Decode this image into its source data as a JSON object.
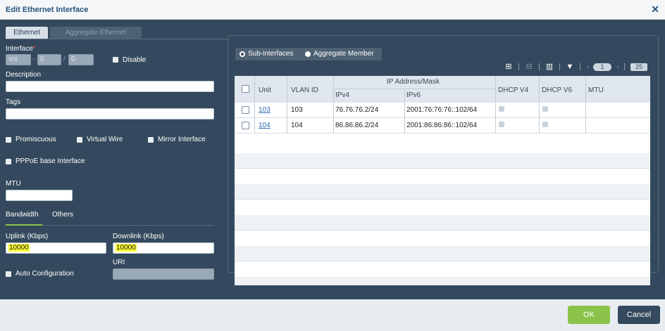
{
  "dialog": {
    "title": "Edit Ethernet Interface"
  },
  "tabs": [
    "Ethernet",
    "Aggregate Ethernet"
  ],
  "left": {
    "interface_label": "Interface",
    "required_mark": "*",
    "interface_parts": [
      "vni",
      "0",
      "0"
    ],
    "separators": [
      "-",
      "/"
    ],
    "disable_label": "Disable",
    "description_label": "Description",
    "tags_label": "Tags",
    "promiscuous_label": "Promiscuous",
    "virtual_wire_label": "Virtual Wire",
    "mirror_interface_label": "Mirror Interface",
    "pppoe_label": "PPPoE base Interface",
    "mtu_label": "MTU",
    "subtabs": [
      "Bandwidth",
      "Others"
    ],
    "uplink_label": "Uplink (Kbps)",
    "uplink_value": "10000",
    "downlink_label": "Downlink (Kbps)",
    "downlink_value": "10000",
    "auto_config_label": "Auto Configuration",
    "uri_label": "URI"
  },
  "right": {
    "radio_sub": "Sub-interfaces",
    "radio_agg": "Aggregate Member",
    "page_number": "1",
    "page_size": "25",
    "columns": {
      "unit": "Unit",
      "vlan": "VLAN ID",
      "ip_group": "IP Address/Mask",
      "ipv4": "IPv4",
      "ipv6": "IPv6",
      "dhcp4": "DHCP V4",
      "dhcp6": "DHCP V6",
      "mtu": "MTU"
    },
    "rows": [
      {
        "unit": "103",
        "vlan": "103",
        "ipv4": "76.76.76.2/24",
        "ipv6": "2001:76:76:76::102/64"
      },
      {
        "unit": "104",
        "vlan": "104",
        "ipv4": "86.86.86.2/24",
        "ipv6": "2001:86:86:86::102/64"
      }
    ]
  },
  "footer": {
    "ok": "OK",
    "cancel": "Cancel"
  }
}
